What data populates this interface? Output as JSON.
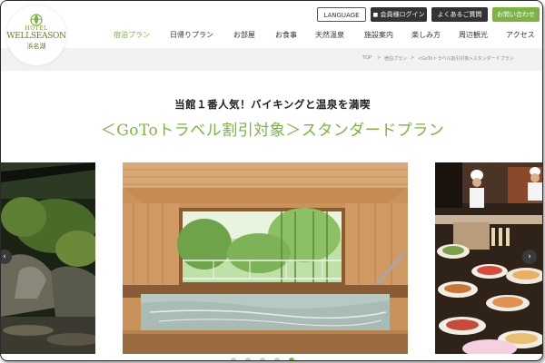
{
  "brand": {
    "hotel": "HOTEL",
    "name": "WELLSEASON",
    "location": "浜名湖"
  },
  "topbar": {
    "language": "LANGUAGE",
    "login": "会員様ログイン",
    "faq": "よくあるご質問",
    "contact": "お問い合わせ"
  },
  "nav": {
    "items": [
      {
        "label": "宿泊プラン",
        "active": true
      },
      {
        "label": "日帰りプラン"
      },
      {
        "label": "お部屋"
      },
      {
        "label": "お食事"
      },
      {
        "label": "天然温泉"
      },
      {
        "label": "施設案内"
      },
      {
        "label": "楽しみ方"
      },
      {
        "label": "周辺観光"
      },
      {
        "label": "アクセス"
      }
    ]
  },
  "breadcrumb": {
    "home": "TOP",
    "sep": ">",
    "plans": "宿泊プラン",
    "current": "<GoToトラベル割引対象>スタンダードプラン"
  },
  "heading": {
    "subtitle": "当館１番人気！バイキングと温泉を満喫",
    "title": "＜GoToトラベル割引対象＞スタンダードプラン"
  },
  "slider": {
    "prev": "‹",
    "next": "›",
    "slide_count": 5,
    "active_index": 4
  },
  "colors": {
    "accent": "#7cb342",
    "dark_button": "#333333",
    "breadcrumb_bg": "#f2f2f2"
  },
  "icons": {
    "login": "lock-icon",
    "faq": "question-icon",
    "contact": "mail-icon",
    "logo": "leaf-emblem-icon"
  }
}
